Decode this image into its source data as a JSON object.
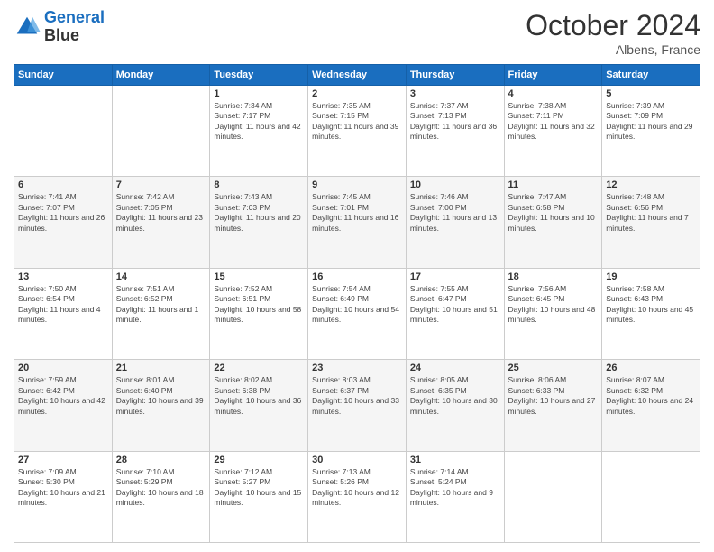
{
  "header": {
    "logo_line1": "General",
    "logo_line2": "Blue",
    "month": "October 2024",
    "location": "Albens, France"
  },
  "weekdays": [
    "Sunday",
    "Monday",
    "Tuesday",
    "Wednesday",
    "Thursday",
    "Friday",
    "Saturday"
  ],
  "weeks": [
    [
      {
        "day": "",
        "info": ""
      },
      {
        "day": "",
        "info": ""
      },
      {
        "day": "1",
        "info": "Sunrise: 7:34 AM\nSunset: 7:17 PM\nDaylight: 11 hours and 42 minutes."
      },
      {
        "day": "2",
        "info": "Sunrise: 7:35 AM\nSunset: 7:15 PM\nDaylight: 11 hours and 39 minutes."
      },
      {
        "day": "3",
        "info": "Sunrise: 7:37 AM\nSunset: 7:13 PM\nDaylight: 11 hours and 36 minutes."
      },
      {
        "day": "4",
        "info": "Sunrise: 7:38 AM\nSunset: 7:11 PM\nDaylight: 11 hours and 32 minutes."
      },
      {
        "day": "5",
        "info": "Sunrise: 7:39 AM\nSunset: 7:09 PM\nDaylight: 11 hours and 29 minutes."
      }
    ],
    [
      {
        "day": "6",
        "info": "Sunrise: 7:41 AM\nSunset: 7:07 PM\nDaylight: 11 hours and 26 minutes."
      },
      {
        "day": "7",
        "info": "Sunrise: 7:42 AM\nSunset: 7:05 PM\nDaylight: 11 hours and 23 minutes."
      },
      {
        "day": "8",
        "info": "Sunrise: 7:43 AM\nSunset: 7:03 PM\nDaylight: 11 hours and 20 minutes."
      },
      {
        "day": "9",
        "info": "Sunrise: 7:45 AM\nSunset: 7:01 PM\nDaylight: 11 hours and 16 minutes."
      },
      {
        "day": "10",
        "info": "Sunrise: 7:46 AM\nSunset: 7:00 PM\nDaylight: 11 hours and 13 minutes."
      },
      {
        "day": "11",
        "info": "Sunrise: 7:47 AM\nSunset: 6:58 PM\nDaylight: 11 hours and 10 minutes."
      },
      {
        "day": "12",
        "info": "Sunrise: 7:48 AM\nSunset: 6:56 PM\nDaylight: 11 hours and 7 minutes."
      }
    ],
    [
      {
        "day": "13",
        "info": "Sunrise: 7:50 AM\nSunset: 6:54 PM\nDaylight: 11 hours and 4 minutes."
      },
      {
        "day": "14",
        "info": "Sunrise: 7:51 AM\nSunset: 6:52 PM\nDaylight: 11 hours and 1 minute."
      },
      {
        "day": "15",
        "info": "Sunrise: 7:52 AM\nSunset: 6:51 PM\nDaylight: 10 hours and 58 minutes."
      },
      {
        "day": "16",
        "info": "Sunrise: 7:54 AM\nSunset: 6:49 PM\nDaylight: 10 hours and 54 minutes."
      },
      {
        "day": "17",
        "info": "Sunrise: 7:55 AM\nSunset: 6:47 PM\nDaylight: 10 hours and 51 minutes."
      },
      {
        "day": "18",
        "info": "Sunrise: 7:56 AM\nSunset: 6:45 PM\nDaylight: 10 hours and 48 minutes."
      },
      {
        "day": "19",
        "info": "Sunrise: 7:58 AM\nSunset: 6:43 PM\nDaylight: 10 hours and 45 minutes."
      }
    ],
    [
      {
        "day": "20",
        "info": "Sunrise: 7:59 AM\nSunset: 6:42 PM\nDaylight: 10 hours and 42 minutes."
      },
      {
        "day": "21",
        "info": "Sunrise: 8:01 AM\nSunset: 6:40 PM\nDaylight: 10 hours and 39 minutes."
      },
      {
        "day": "22",
        "info": "Sunrise: 8:02 AM\nSunset: 6:38 PM\nDaylight: 10 hours and 36 minutes."
      },
      {
        "day": "23",
        "info": "Sunrise: 8:03 AM\nSunset: 6:37 PM\nDaylight: 10 hours and 33 minutes."
      },
      {
        "day": "24",
        "info": "Sunrise: 8:05 AM\nSunset: 6:35 PM\nDaylight: 10 hours and 30 minutes."
      },
      {
        "day": "25",
        "info": "Sunrise: 8:06 AM\nSunset: 6:33 PM\nDaylight: 10 hours and 27 minutes."
      },
      {
        "day": "26",
        "info": "Sunrise: 8:07 AM\nSunset: 6:32 PM\nDaylight: 10 hours and 24 minutes."
      }
    ],
    [
      {
        "day": "27",
        "info": "Sunrise: 7:09 AM\nSunset: 5:30 PM\nDaylight: 10 hours and 21 minutes."
      },
      {
        "day": "28",
        "info": "Sunrise: 7:10 AM\nSunset: 5:29 PM\nDaylight: 10 hours and 18 minutes."
      },
      {
        "day": "29",
        "info": "Sunrise: 7:12 AM\nSunset: 5:27 PM\nDaylight: 10 hours and 15 minutes."
      },
      {
        "day": "30",
        "info": "Sunrise: 7:13 AM\nSunset: 5:26 PM\nDaylight: 10 hours and 12 minutes."
      },
      {
        "day": "31",
        "info": "Sunrise: 7:14 AM\nSunset: 5:24 PM\nDaylight: 10 hours and 9 minutes."
      },
      {
        "day": "",
        "info": ""
      },
      {
        "day": "",
        "info": ""
      }
    ]
  ]
}
